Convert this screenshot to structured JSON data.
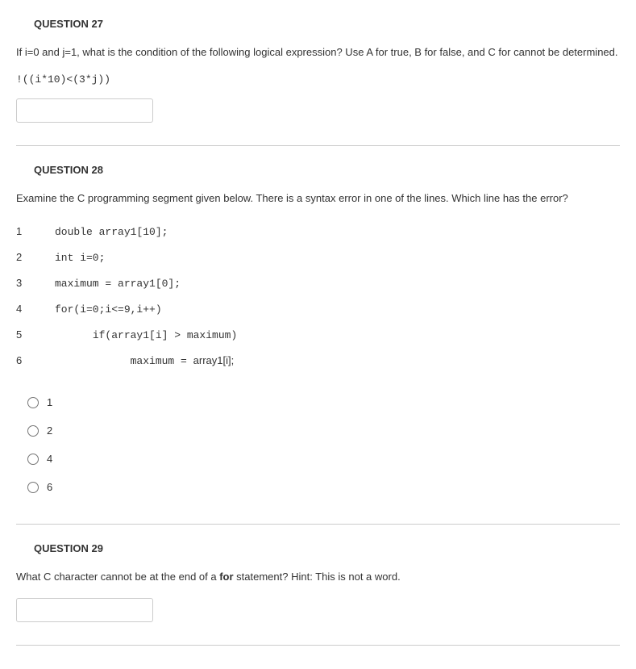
{
  "q27": {
    "header": "QUESTION 27",
    "prompt": "If i=0 and j=1, what is the condition of the following logical expression?  Use A for true, B for false, and C for cannot be determined.",
    "expr": "!((i*10)<(3*j))",
    "input_value": ""
  },
  "q28": {
    "header": "QUESTION 28",
    "prompt": "Examine the C programming segment given below.  There is a syntax error in one of the lines.  Which line has the error?",
    "lines": [
      {
        "n": "1",
        "code": "double array1[10];",
        "indent": ""
      },
      {
        "n": "2",
        "code": "int i=0;",
        "indent": ""
      },
      {
        "n": "3",
        "code": "maximum = array1[0];",
        "indent": ""
      },
      {
        "n": "4",
        "code": "for(i=0;i<=9,i++)",
        "indent": ""
      },
      {
        "n": "5",
        "code": "if(array1[i] > maximum)",
        "indent": "      "
      },
      {
        "n": "6",
        "code_mono": "maximum = ",
        "code_sans": "array1[i];",
        "indent": "            "
      }
    ],
    "options": [
      "1",
      "2",
      "4",
      "6"
    ]
  },
  "q29": {
    "header": "QUESTION 29",
    "prompt_before": "What C character cannot be at the end of a ",
    "prompt_bold": "for",
    "prompt_after": " statement?  Hint: This is not a word.",
    "input_value": ""
  }
}
